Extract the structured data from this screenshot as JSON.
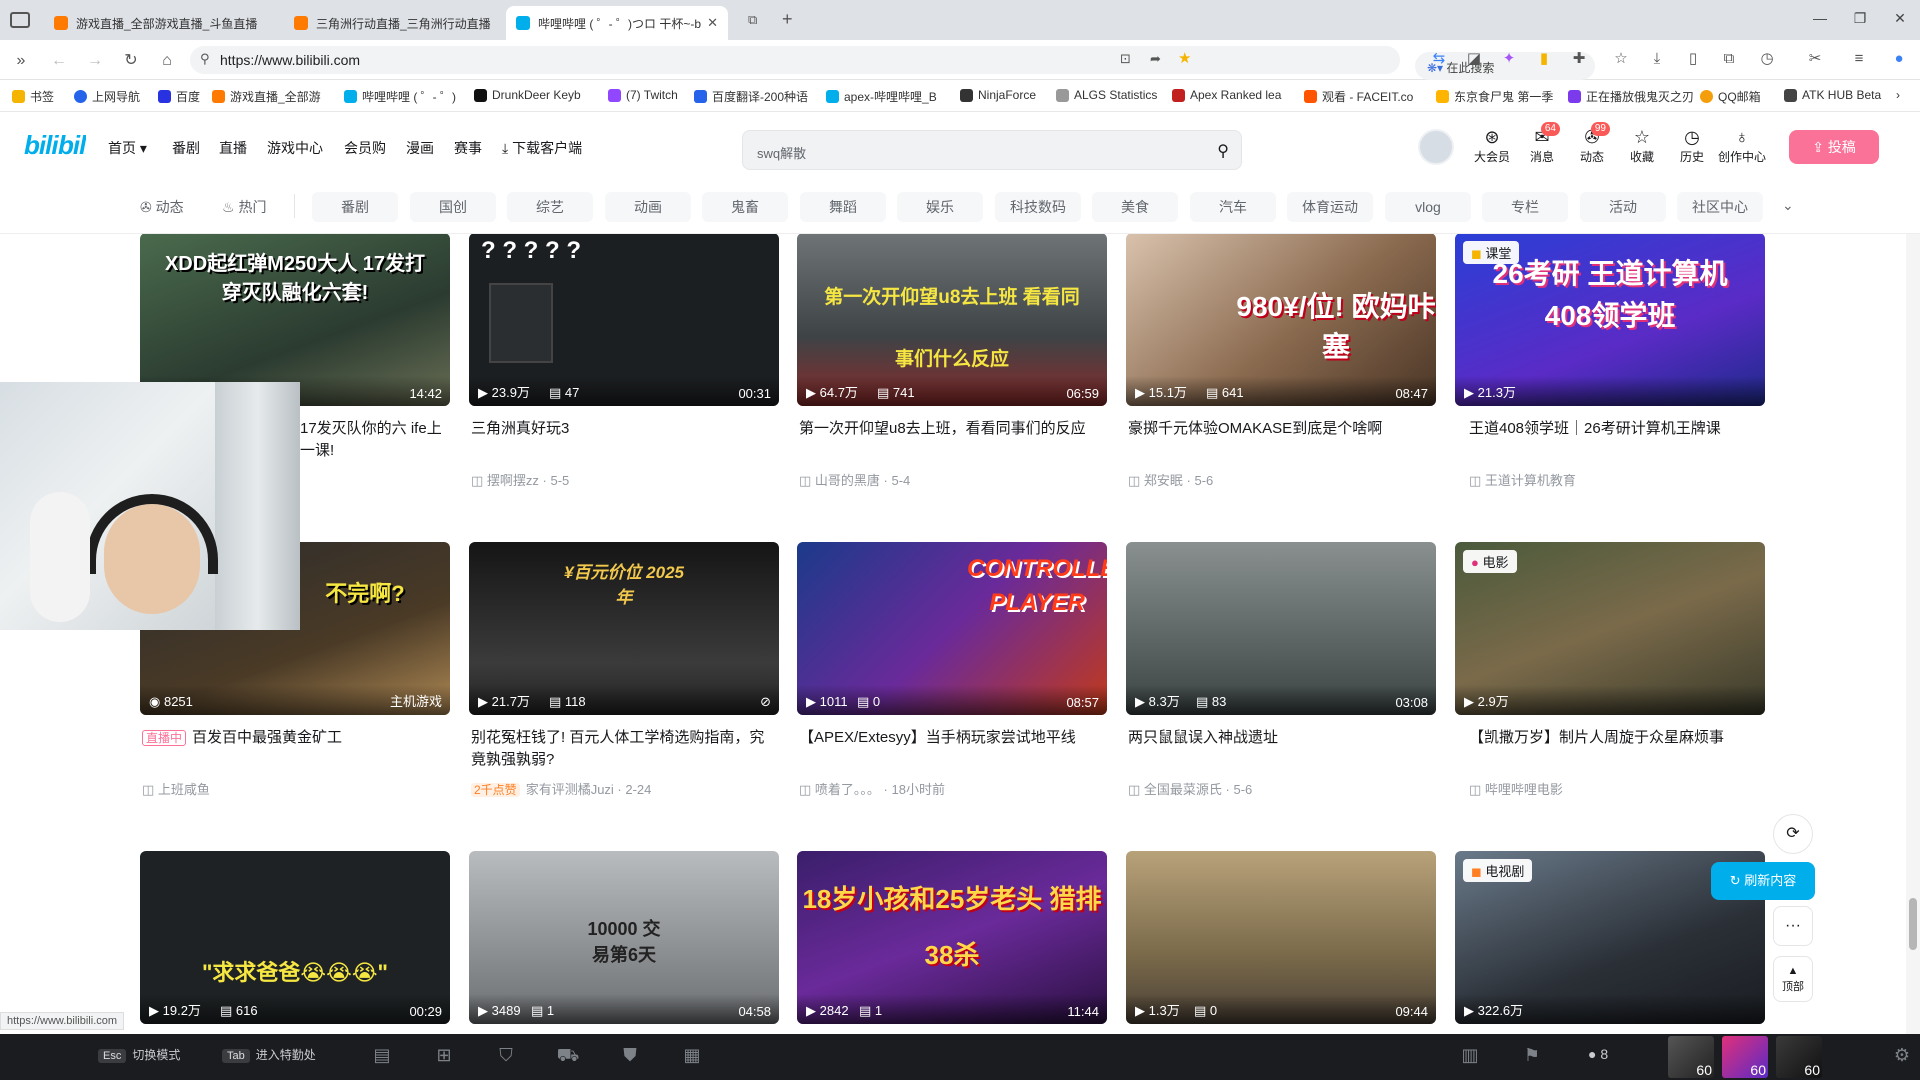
{
  "browser": {
    "tabs": [
      {
        "title": "游戏直播_全部游戏直播_斗鱼直播",
        "active": false
      },
      {
        "title": "三角洲行动直播_三角洲行动直播",
        "active": false
      },
      {
        "title": "哔哩哔哩 ( ゜- ゜)つロ 干杯~-b",
        "active": true
      }
    ],
    "url": "https://www.bilibili.com",
    "search_label": "在此搜索",
    "bookmarks": [
      "书签",
      "上网导航",
      "百度",
      "游戏直播_全部游",
      "哔哩哔哩 ( ゜- ゜)",
      "DrunkDeer Keyb",
      "(7) Twitch",
      "百度翻译-200种语",
      "apex-哔哩哔哩_B",
      "NinjaForce",
      "ALGS Statistics",
      "Apex Ranked lea",
      "观看 - FACEIT.co",
      "东京食尸鬼 第一季",
      "正在播放俄鬼灭之刃",
      "QQ邮箱",
      "ATK HUB Beta"
    ]
  },
  "header": {
    "nav": [
      "首页",
      "番剧",
      "直播",
      "游戏中心",
      "会员购",
      "漫画",
      "赛事",
      "下载客户端"
    ],
    "search_placeholder": "swq解散",
    "icons": [
      {
        "label": "大会员",
        "badge": ""
      },
      {
        "label": "消息",
        "badge": "64"
      },
      {
        "label": "动态",
        "badge": "99"
      },
      {
        "label": "收藏",
        "badge": ""
      },
      {
        "label": "历史",
        "badge": ""
      },
      {
        "label": "创作中心",
        "badge": ""
      }
    ],
    "upload_label": "投稿"
  },
  "channels": {
    "left": [
      "动态",
      "热门"
    ],
    "pills": [
      "番剧",
      "国创",
      "综艺",
      "动画",
      "鬼畜",
      "舞蹈",
      "娱乐",
      "科技数码",
      "美食",
      "汽车",
      "体育运动",
      "vlog",
      "专栏",
      "活动",
      "社区中心"
    ]
  },
  "feed": {
    "rows": [
      [
        {
          "thumb_text": "XDD起红弹M250大人 17发打穿灭队融化六套!",
          "plays": "",
          "danmaku": "",
          "duration": "14:42",
          "title": "17发灭队你的六 ife上一课!",
          "author": "",
          "date": "",
          "chip": "",
          "badge": ""
        },
        {
          "thumb_text": "? ? ? ? ?",
          "plays": "23.9万",
          "danmaku": "47",
          "duration": "00:31",
          "title": "三角洲真好玩3",
          "author": "摆啊摆zz",
          "date": "5-5",
          "chip": "",
          "badge": ""
        },
        {
          "thumb_text": "第一次开仰望u8去上班 看看同事们什么反应",
          "plays": "64.7万",
          "danmaku": "741",
          "duration": "06:59",
          "title": "第一次开仰望u8去上班，看看同事们的反应",
          "author": "山哥的黑唐",
          "date": "5-4",
          "chip": "",
          "badge": ""
        },
        {
          "thumb_text": "980¥/位! 欧妈咔塞",
          "plays": "15.1万",
          "danmaku": "641",
          "duration": "08:47",
          "title": "豪掷千元体验OMAKASE到底是个啥啊",
          "author": "郑安眠",
          "date": "5-6",
          "chip": "",
          "badge": ""
        },
        {
          "thumb_text": "26考研 王道计算机 408领学班",
          "plays": "21.3万",
          "danmaku": "",
          "duration": "",
          "title": "王道408领学班｜26考研计算机王牌课",
          "author": "王道计算机教育",
          "date": "",
          "chip": "课堂",
          "badge": ""
        }
      ],
      [
        {
          "thumb_text": "不完啊?",
          "plays": "8251",
          "danmaku": "",
          "duration": "主机游戏",
          "title": "百发百中最强黄金矿工",
          "author": "上班咸鱼",
          "date": "",
          "chip": "",
          "badge": "直播中"
        },
        {
          "thumb_text": "¥百元价位 2025年",
          "plays": "21.7万",
          "danmaku": "118",
          "duration": "",
          "title": "别花冤枉钱了! 百元人体工学椅选购指南，究竟孰强孰弱?",
          "author": "家有评测橘Juzi",
          "date": "2-24",
          "chip": "",
          "badge": "2千点赞"
        },
        {
          "thumb_text": "CONTROLLER PLAYER",
          "plays": "1011",
          "danmaku": "0",
          "duration": "08:57",
          "title": "【APEX/Extesyy】当手柄玩家尝试地平线",
          "author": "喷着了。。。",
          "date": "18小时前",
          "chip": "",
          "badge": ""
        },
        {
          "thumb_text": "",
          "plays": "8.3万",
          "danmaku": "83",
          "duration": "03:08",
          "title": "两只鼠鼠误入神战遗址",
          "author": "全国最菜源氏",
          "date": "5-6",
          "chip": "",
          "badge": ""
        },
        {
          "thumb_text": "",
          "plays": "2.9万",
          "danmaku": "",
          "duration": "",
          "title": "【凯撒万岁】制片人周旋于众星麻烦事",
          "author": "哔哩哔哩电影",
          "date": "",
          "chip": "电影",
          "badge": ""
        }
      ],
      [
        {
          "thumb_text": "\"求求爸爸😭😭😭\"",
          "plays": "19.2万",
          "danmaku": "616",
          "duration": "00:29",
          "title": "",
          "author": "",
          "date": "",
          "chip": "",
          "badge": ""
        },
        {
          "thumb_text": "10000 交易第6天",
          "plays": "3489",
          "danmaku": "1",
          "duration": "04:58",
          "title": "",
          "author": "",
          "date": "",
          "chip": "",
          "badge": ""
        },
        {
          "thumb_text": "18岁小孩和25岁老头 猎排38杀",
          "plays": "2842",
          "danmaku": "1",
          "duration": "11:44",
          "title": "",
          "author": "",
          "date": "",
          "chip": "",
          "badge": ""
        },
        {
          "thumb_text": "",
          "plays": "1.3万",
          "danmaku": "0",
          "duration": "09:44",
          "title": "",
          "author": "",
          "date": "",
          "chip": "",
          "badge": ""
        },
        {
          "thumb_text": "",
          "plays": "322.6万",
          "danmaku": "",
          "duration": "",
          "title": "",
          "author": "",
          "date": "",
          "chip": "电视剧",
          "badge": ""
        }
      ]
    ]
  },
  "side": {
    "refresh_label": "刷新内容",
    "top_label": "顶部"
  },
  "status_url": "https://www.bilibili.com",
  "gamebar": {
    "keys": [
      {
        "key": "Esc",
        "label": "切换模式"
      },
      {
        "key": "Tab",
        "label": "进入特勤处"
      }
    ],
    "count": "8",
    "portraits": [
      "60",
      "60",
      "60"
    ]
  },
  "colors": {
    "bili_blue": "#00aeec",
    "bili_pink": "#fb7299"
  }
}
